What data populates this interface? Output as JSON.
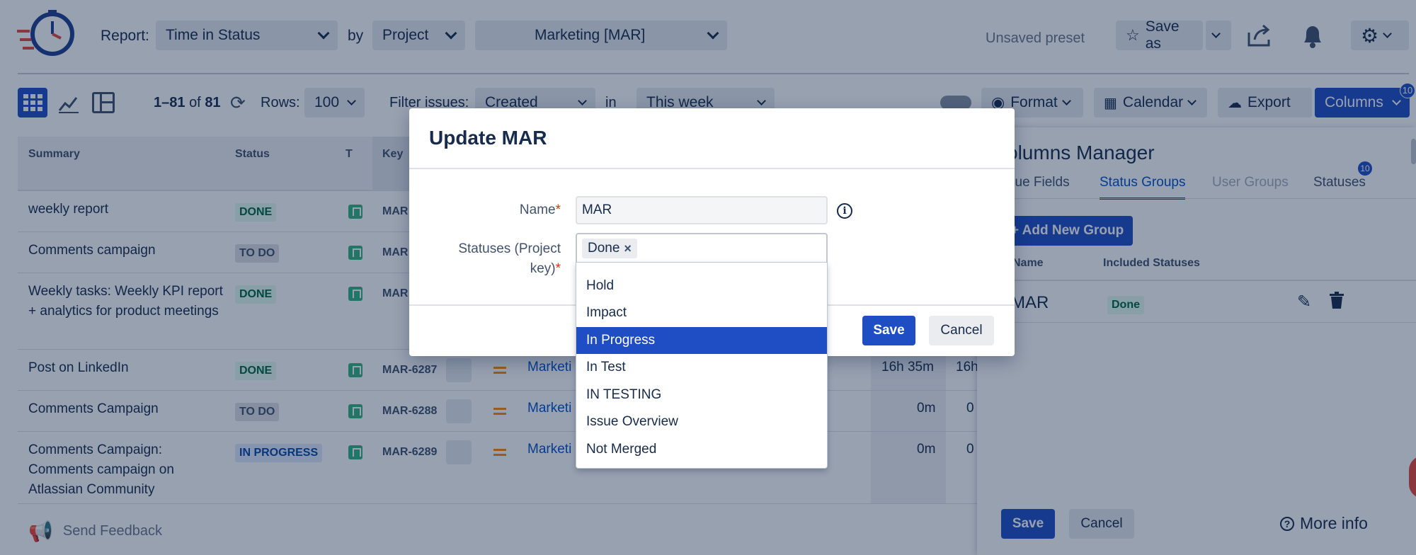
{
  "header": {
    "report_label": "Report:",
    "report_value": "Time in Status",
    "by_label": "by",
    "by_value": "Project",
    "project_value": "Marketing [MAR]",
    "unsaved": "Unsaved preset",
    "save_as": "Save as"
  },
  "toolbar": {
    "range": "1–81",
    "of": "of",
    "total": "81",
    "rows_label": "Rows:",
    "rows_value": "100",
    "filter_label": "Filter issues:",
    "filter_value": "Created",
    "in_label": "in",
    "period_value": "This week",
    "format": "Format",
    "calendar": "Calendar",
    "export": "Export",
    "columns": "Columns",
    "columns_badge": "10"
  },
  "table": {
    "headers": {
      "summary": "Summary",
      "status": "Status",
      "type": "T",
      "key": "Key"
    },
    "rows": [
      {
        "summary": "weekly report",
        "status": "DONE",
        "key": "MAR",
        "link": "",
        "t1": "",
        "t2": ""
      },
      {
        "summary": "Comments campaign",
        "status": "TO DO",
        "key": "MAR",
        "link": "",
        "t1": "",
        "t2": ""
      },
      {
        "summary": "Weekly tasks: Weekly KPI report + analytics for product meetings",
        "status": "DONE",
        "key": "MAR",
        "link": "",
        "t1": "",
        "t2": ""
      },
      {
        "summary": "Post on LinkedIn",
        "status": "DONE",
        "key": "MAR-6287",
        "link": "Marketi",
        "t1": "16h 35m",
        "t2": "16h"
      },
      {
        "summary": "Comments Campaign",
        "status": "TO DO",
        "key": "MAR-6288",
        "link": "Marketi",
        "t1": "0m",
        "t2": "0"
      },
      {
        "summary": "Comments Campaign: Comments campaign on Atlassian Community",
        "status": "IN PROGRESS",
        "key": "MAR-6289",
        "link": "Marketi",
        "t1": "0m",
        "t2": "0"
      }
    ]
  },
  "feedback": "Send Feedback",
  "columns_manager": {
    "title": "olumns Manager",
    "tabs": [
      "sue Fields",
      "Status Groups",
      "User Groups",
      "Statuses"
    ],
    "statuses_badge": "10",
    "add_group": "+ Add New Group",
    "col_name": "Name",
    "col_included": "Included Statuses",
    "group_name": "MAR",
    "group_status": "Done",
    "save": "Save",
    "cancel": "Cancel",
    "more_info": "More info"
  },
  "modal": {
    "title": "Update MAR",
    "name_label": "Name",
    "name_value": "MAR",
    "statuses_label_1": "Statuses (Project",
    "statuses_label_2": "key)",
    "required_mark": "*",
    "chip": "Done",
    "save": "Save",
    "cancel": "Cancel",
    "options": [
      "Hold",
      "Impact",
      "In Progress",
      "In Test",
      "IN TESTING",
      "Issue Overview",
      "Not Merged"
    ],
    "selected_index": 2
  },
  "colors": {
    "primary": "#1f4ec4",
    "overlay": "#091e42"
  }
}
